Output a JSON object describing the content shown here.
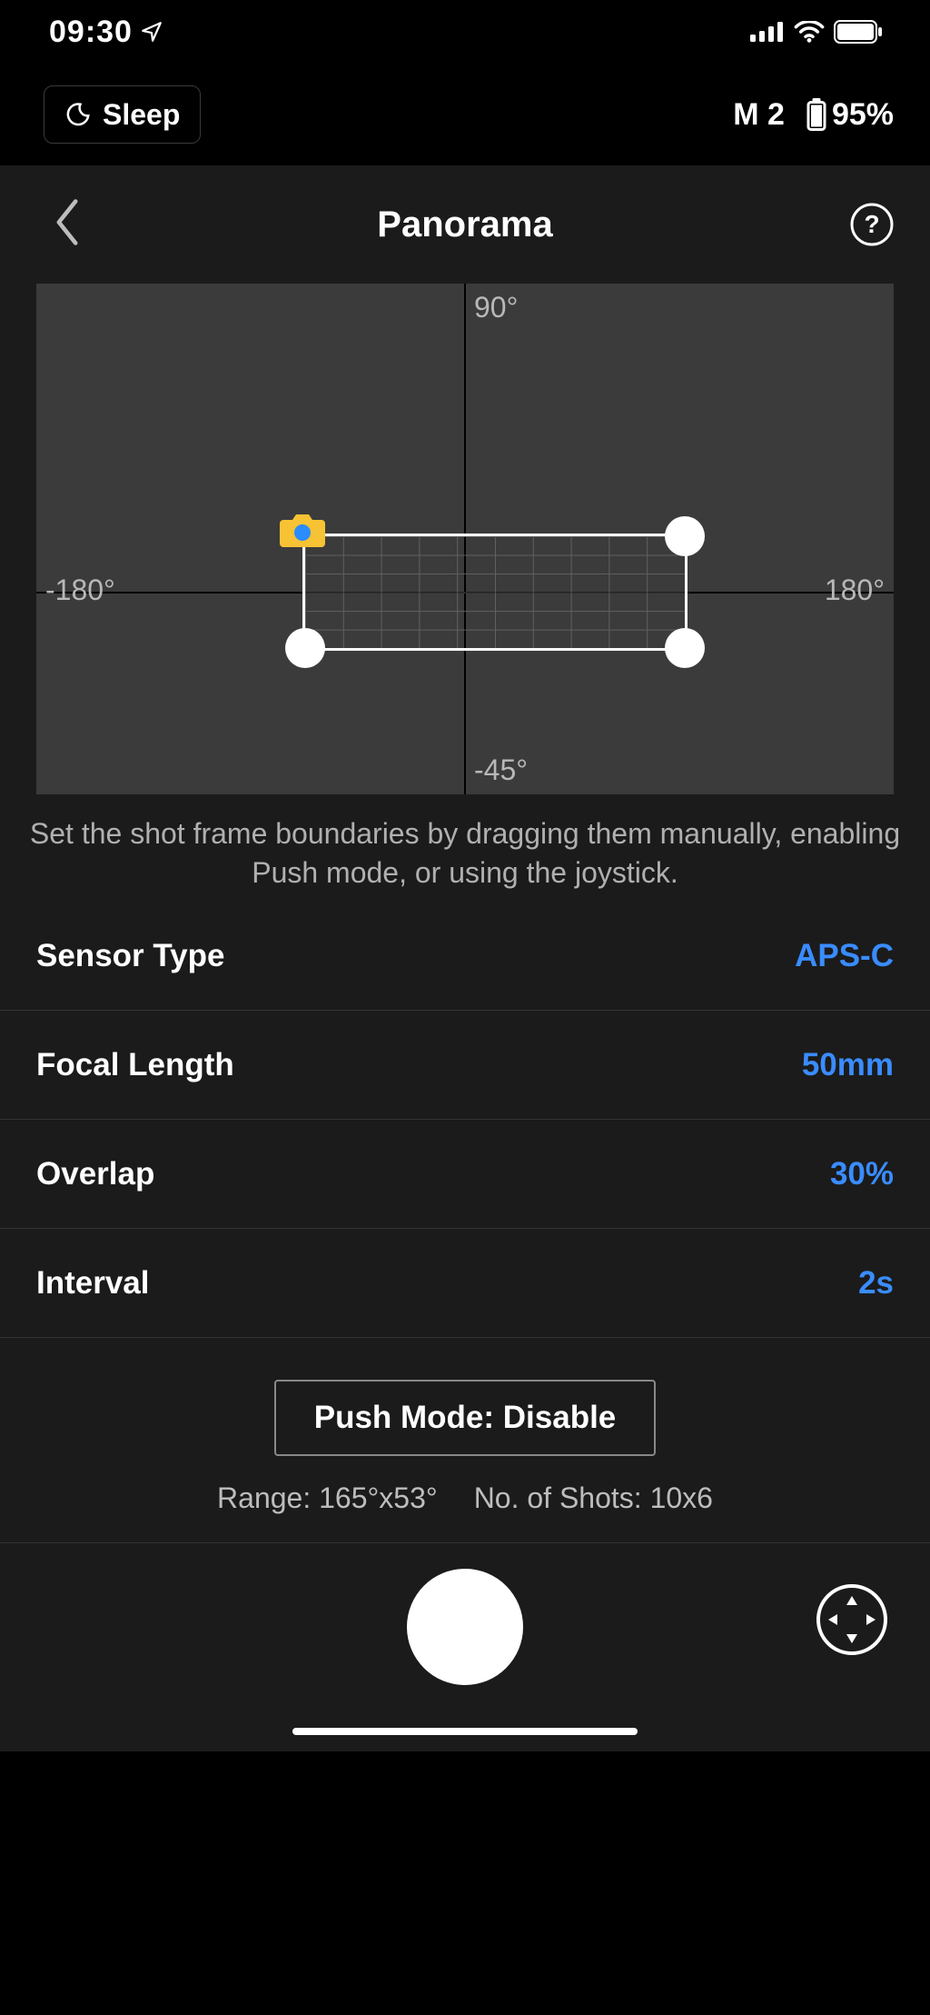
{
  "status_bar": {
    "time": "09:30"
  },
  "app_bar": {
    "sleep_label": "Sleep",
    "mode_label": "M 2",
    "battery_percent": "95%"
  },
  "header": {
    "title": "Panorama"
  },
  "pano": {
    "top_label": "90°",
    "left_label": "-180°",
    "right_label": "180°",
    "bottom_label": "-45°"
  },
  "hint": "Set the shot frame boundaries by dragging them manually, enabling Push mode, or using the joystick.",
  "rows": {
    "sensor_label": "Sensor Type",
    "sensor_value": "APS-C",
    "focal_label": "Focal Length",
    "focal_value": "50mm",
    "overlap_label": "Overlap",
    "overlap_value": "30%",
    "interval_label": "Interval",
    "interval_value": "2s"
  },
  "push_mode": {
    "button_label": "Push Mode: Disable",
    "range_label": "Range: 165°x53°",
    "shots_label": "No. of Shots: 10x6"
  }
}
